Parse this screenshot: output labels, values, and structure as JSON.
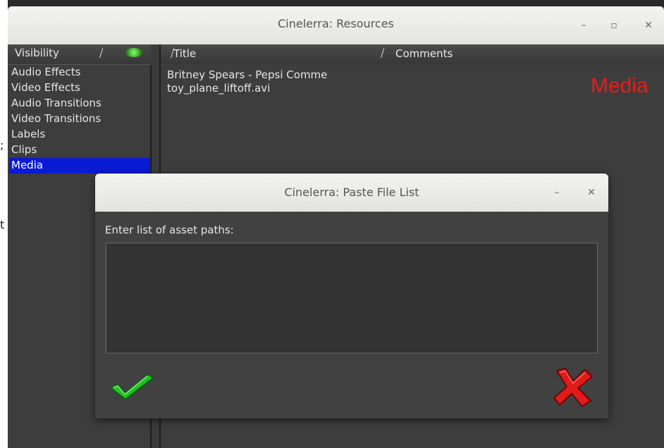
{
  "stray_chars": {
    "char1": ";",
    "char2": "t"
  },
  "main_window": {
    "title": "Cinelerra: Resources",
    "controls": {
      "minimize": "–",
      "maximize": "▫",
      "close": "✕"
    },
    "visibility": {
      "label": "Visibility",
      "led_color": "#3fbf2a"
    },
    "folders": [
      {
        "label": "Audio Effects",
        "selected": false
      },
      {
        "label": "Video Effects",
        "selected": false
      },
      {
        "label": "Audio Transitions",
        "selected": false
      },
      {
        "label": "Video Transitions",
        "selected": false
      },
      {
        "label": "Labels",
        "selected": false
      },
      {
        "label": "Clips",
        "selected": false
      },
      {
        "label": "Media",
        "selected": true
      }
    ],
    "columns": {
      "title": "Title",
      "comments": "Comments"
    },
    "assets": [
      {
        "title": "Britney Spears - Pepsi Comme"
      },
      {
        "title": "toy_plane_liftoff.avi"
      }
    ],
    "folder_heading": "Media",
    "folder_heading_color": "#ee1a1a",
    "selection_color": "#0a1bd6"
  },
  "dialog": {
    "title": "Cinelerra: Paste File List",
    "controls": {
      "minimize": "–",
      "close": "✕"
    },
    "prompt": "Enter list of asset paths:",
    "textarea_value": "",
    "ok_icon": "checkmark-icon",
    "cancel_icon": "cross-icon",
    "ok_color": "#1fc21f",
    "cancel_color": "#e01b1b"
  }
}
